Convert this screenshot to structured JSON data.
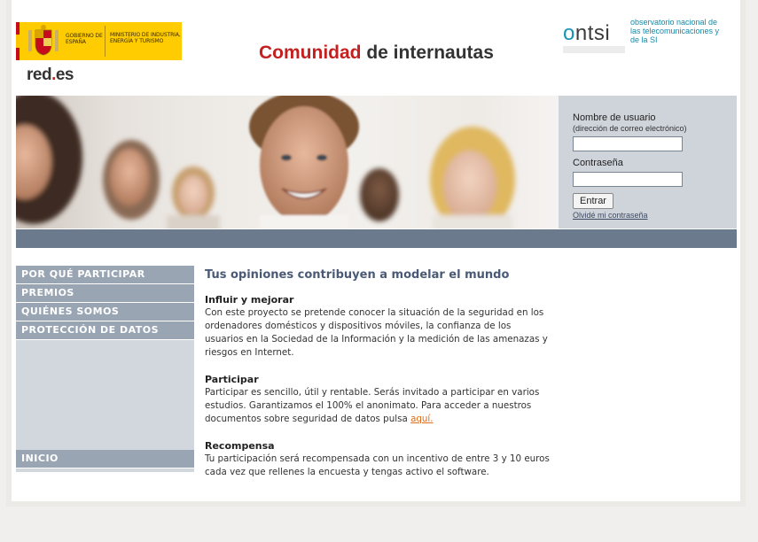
{
  "header": {
    "gobierno_text": "GOBIERNO DE ESPAÑA",
    "ministerio_text": "MINISTERIO DE INDUSTRIA, ENERGÍA Y TURISMO",
    "redes_logo": {
      "main": "red",
      "dot": ".",
      "rest": "es"
    },
    "title_part1": "Comunidad",
    "title_part2": "de internautas",
    "ontsi": {
      "word_o": "o",
      "word_rest": "ntsi",
      "desc": "observatorio nacional de las telecomunicaciones y de la SI"
    }
  },
  "login": {
    "username_label": "Nombre de usuario",
    "username_sublabel": "(dirección de correo electrónico)",
    "username_value": "",
    "password_label": "Contraseña",
    "password_value": "",
    "submit_label": "Entrar",
    "forgot_link": "Olvidé mi contraseña"
  },
  "sidebar": {
    "items": [
      {
        "label": "POR QUÉ PARTICIPAR"
      },
      {
        "label": "PREMIOS"
      },
      {
        "label": "QUIÉNES SOMOS"
      },
      {
        "label": "PROTECCIÓN DE DATOS"
      },
      {
        "label": "INICIO"
      }
    ]
  },
  "content": {
    "heading": "Tus opiniones contribuyen a modelar el mundo",
    "sections": [
      {
        "title": "Influir y mejorar",
        "body": "Con este proyecto se pretende conocer la situación de la seguridad en los ordenadores domésticos y dispositivos móviles, la confianza de los usuarios en la Sociedad de la Información y la medición de las amenazas y riesgos en Internet."
      },
      {
        "title": "Participar",
        "body": "Participar es sencillo, útil y rentable. Serás invitado a participar en varios estudios. Garantizamos el 100% el anonimato. Para acceder a nuestros documentos sobre seguridad de datos pulsa ",
        "link": "aquí."
      },
      {
        "title": "Recompensa",
        "body": "Tu participación será recompensada con un incentivo de entre 3 y 10 euros cada vez que rellenes la encuesta y tengas activo el software."
      }
    ]
  },
  "colors": {
    "title_red": "#c51f1f",
    "nav_bg": "#9aa5b3",
    "stripe": "#6b7a8c",
    "login_bg": "#cfd4db",
    "link_orange": "#e06d1b",
    "heading_blue": "#4a5a76"
  }
}
